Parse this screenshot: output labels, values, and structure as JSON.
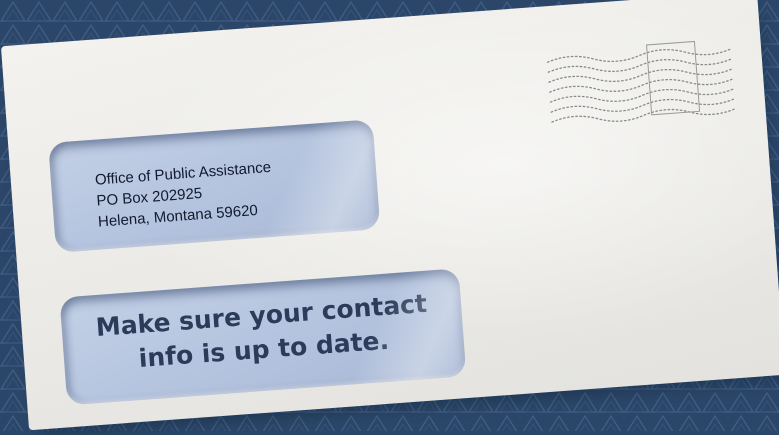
{
  "envelope": {
    "address_lines": [
      "Office of Public Assistance",
      "PO Box 202925",
      "Helena, Montana 59620"
    ],
    "message_lines": [
      "Make sure your contact",
      "info is up to date."
    ]
  },
  "colors": {
    "background": "#2b4668",
    "pattern_line": "#3d5a80",
    "envelope": "#eeede9",
    "window_tint": "#b4c3de",
    "message_text": "#2b3c5a",
    "address_text": "#111a2e"
  },
  "icons": {
    "postmark": "postmark-wavy-lines-icon",
    "background": "triangle-pattern"
  }
}
